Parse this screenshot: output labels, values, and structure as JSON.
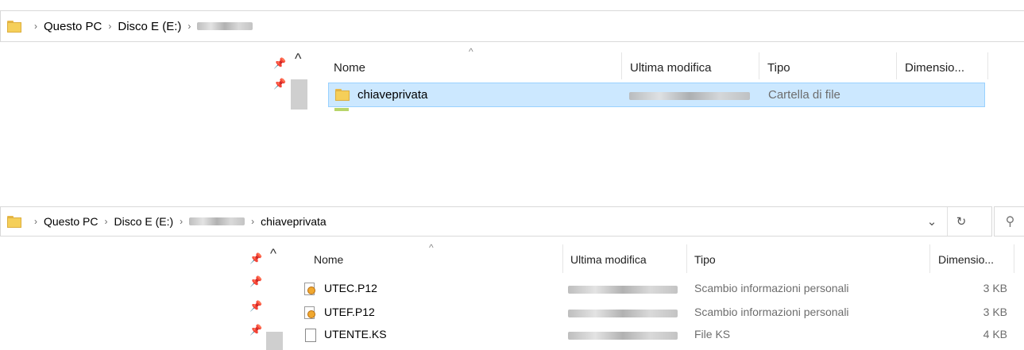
{
  "pane1": {
    "breadcrumb": [
      "Questo PC",
      "Disco E (E:)"
    ],
    "columns": {
      "name": "Nome",
      "modified": "Ultima modifica",
      "type": "Tipo",
      "size": "Dimensio..."
    },
    "rows": [
      {
        "name": "chiaveprivata",
        "type": "Cartella di file",
        "size": ""
      }
    ]
  },
  "pane2": {
    "breadcrumb": [
      "Questo PC",
      "Disco E (E:)",
      "chiaveprivata"
    ],
    "columns": {
      "name": "Nome",
      "modified": "Ultima modifica",
      "type": "Tipo",
      "size": "Dimensio..."
    },
    "rows": [
      {
        "name": "UTEC.P12",
        "type": "Scambio informazioni personali",
        "size": "3 KB",
        "icon": "certificate-icon"
      },
      {
        "name": "UTEF.P12",
        "type": "Scambio informazioni personali",
        "size": "3 KB",
        "icon": "certificate-icon"
      },
      {
        "name": "UTENTE.KS",
        "type": "File KS",
        "size": "4 KB",
        "icon": "file-icon"
      }
    ]
  },
  "icons": {
    "chevron": "›",
    "pin": "✈",
    "up": "^",
    "dropdown": "⌄",
    "refresh": "↻",
    "search": "⚲"
  }
}
